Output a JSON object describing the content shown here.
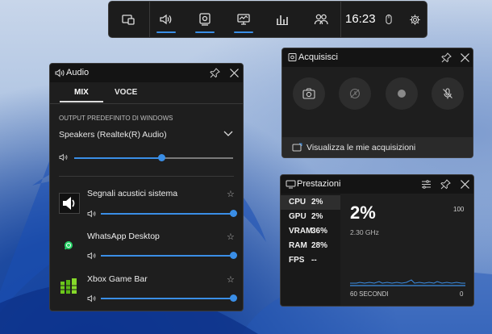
{
  "topbar": {
    "time": "16:23",
    "buttons": [
      {
        "name": "widget-menu",
        "icon": "widget-menu-icon",
        "active": false
      },
      {
        "name": "audio",
        "icon": "speaker-icon",
        "active": true
      },
      {
        "name": "capture",
        "icon": "capture-icon",
        "active": true
      },
      {
        "name": "performance",
        "icon": "monitor-icon",
        "active": true
      },
      {
        "name": "resources",
        "icon": "bar-chart-icon",
        "active": false
      },
      {
        "name": "social",
        "icon": "people-icon",
        "active": false
      }
    ],
    "right_icons": [
      "mouse-icon",
      "settings-icon"
    ]
  },
  "audio": {
    "title": "Audio",
    "tabs": [
      "MIX",
      "VOCE"
    ],
    "active_tab": "MIX",
    "output_label": "OUTPUT PREDEFINITO DI WINDOWS",
    "device": "Speakers (Realtek(R) Audio)",
    "master_volume": 0.55,
    "apps": [
      {
        "name": "Segnali acustici sistema",
        "icon": "speaker-app-icon",
        "volume": 1.0
      },
      {
        "name": "WhatsApp Desktop",
        "icon": "whatsapp-icon",
        "volume": 1.0
      },
      {
        "name": "Xbox Game Bar",
        "icon": "xbox-game-bar-icon",
        "volume": 1.0
      }
    ]
  },
  "capture": {
    "title": "Acquisisci",
    "buttons": [
      "screenshot-icon",
      "record-last-icon",
      "record-icon",
      "mic-off-icon"
    ],
    "link": "Visualizza le mie acquisizioni"
  },
  "performance": {
    "title": "Prestazioni",
    "metrics": [
      {
        "key": "CPU",
        "value": "2%"
      },
      {
        "key": "GPU",
        "value": "2%"
      },
      {
        "key": "VRAM",
        "value": "36%"
      },
      {
        "key": "RAM",
        "value": "28%"
      },
      {
        "key": "FPS",
        "value": "--"
      }
    ],
    "selected": "CPU",
    "big_value": "2%",
    "frequency": "2.30 GHz",
    "axis_max": "100",
    "axis_min": "0",
    "time_window": "60 SECONDI"
  },
  "colors": {
    "accent": "#3a8ee6",
    "panel": "#1e1e1e",
    "titlebar": "#141414"
  }
}
